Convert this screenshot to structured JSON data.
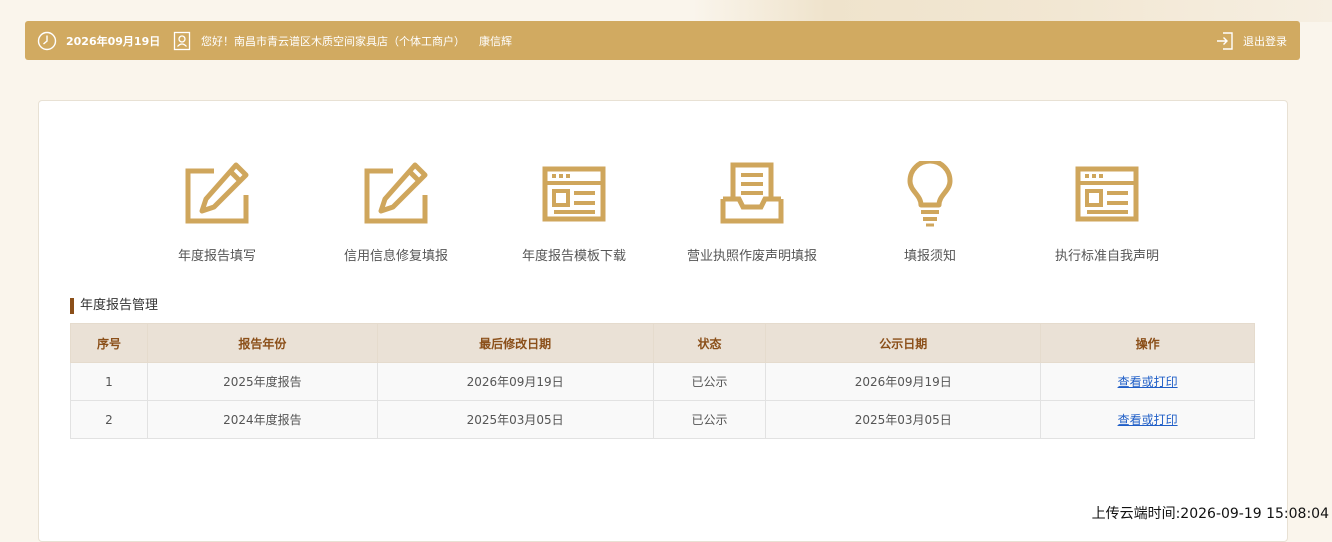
{
  "header": {
    "date": "2026年09月19日",
    "greeting": "您好！南昌市青云谱区木质空间家具店（个体工商户）",
    "user_name": "康信辉",
    "logout_label": "退出登录"
  },
  "quick_links": [
    {
      "label": "年度报告填写",
      "icon": "edit-pencil-icon"
    },
    {
      "label": "信用信息修复填报",
      "icon": "edit-pencil-icon"
    },
    {
      "label": "年度报告模板下载",
      "icon": "window-form-icon"
    },
    {
      "label": "营业执照作废声明填报",
      "icon": "document-tray-icon"
    },
    {
      "label": "填报须知",
      "icon": "lightbulb-icon"
    },
    {
      "label": "执行标准自我声明",
      "icon": "window-form-icon"
    }
  ],
  "section": {
    "title": "年度报告管理"
  },
  "table": {
    "headers": [
      "序号",
      "报告年份",
      "最后修改日期",
      "状态",
      "公示日期",
      "操作"
    ],
    "rows": [
      {
        "no": "1",
        "year": "2025年度报告",
        "modified": "2026年09月19日",
        "status": "已公示",
        "publish": "2026年09月19日",
        "action": "查看或打印"
      },
      {
        "no": "2",
        "year": "2024年度报告",
        "modified": "2025年03月05日",
        "status": "已公示",
        "publish": "2025年03月05日",
        "action": "查看或打印"
      }
    ]
  },
  "footer": {
    "upload_time": "上传云端时间:2026-09-19 15:08:04"
  },
  "colors": {
    "accent": "#d1aa61",
    "icon": "#cfa65c",
    "section_marker": "#8b4f19",
    "link": "#1f5ec7"
  }
}
